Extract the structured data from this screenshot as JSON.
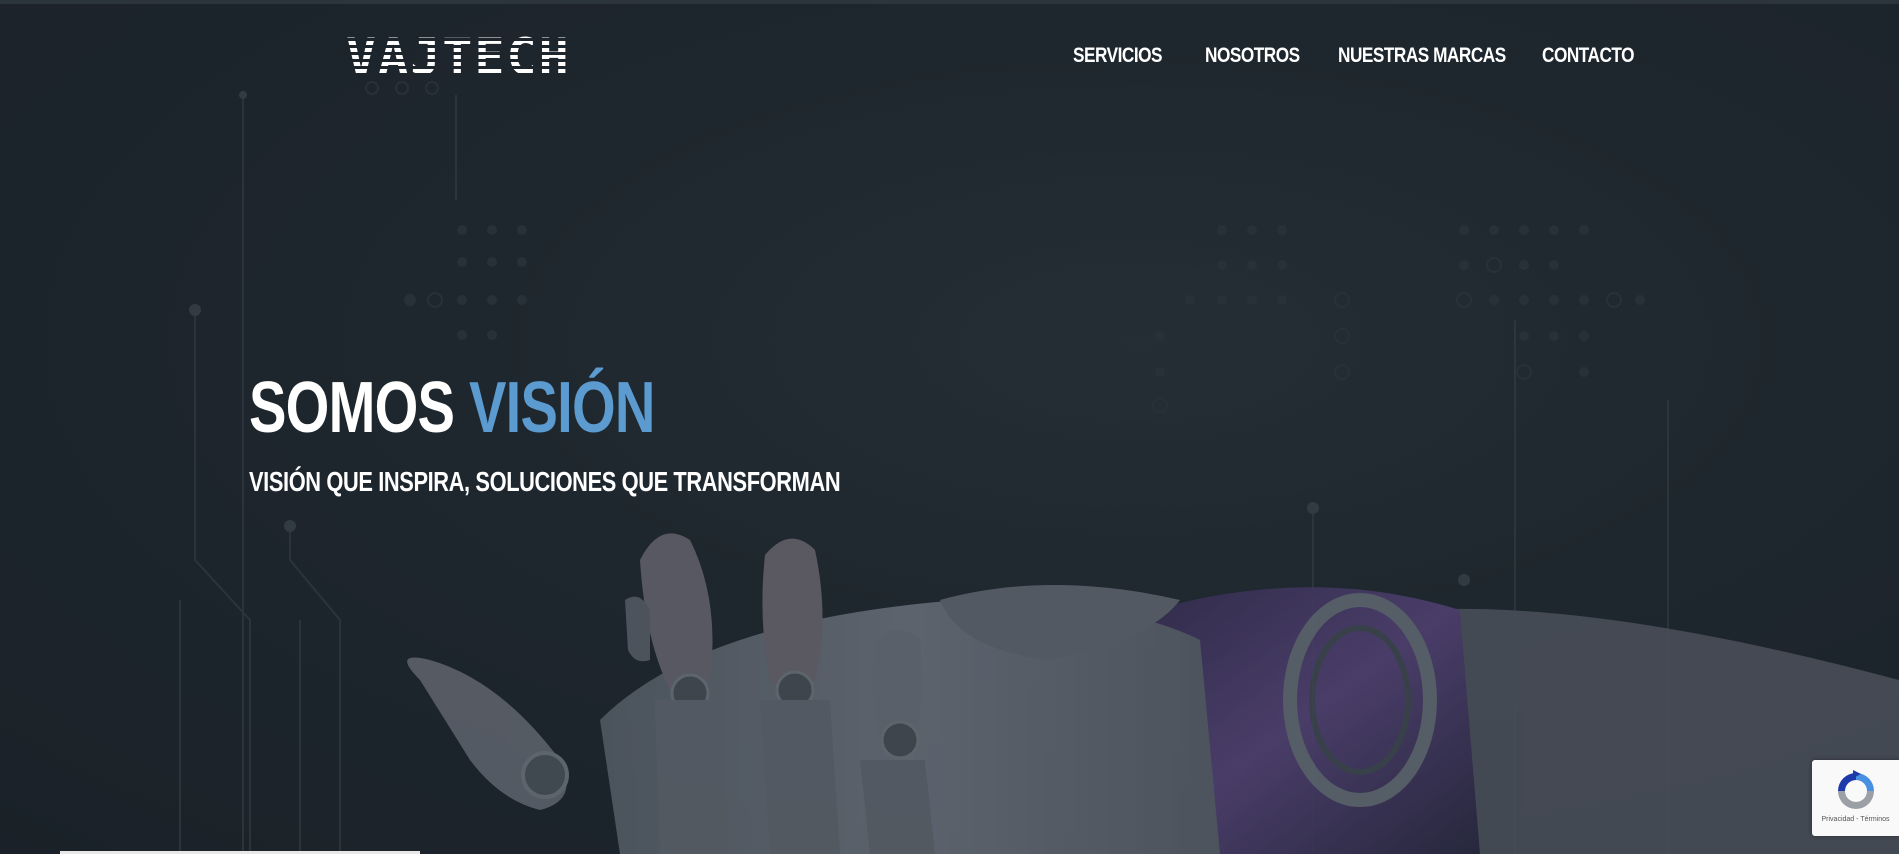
{
  "brand": {
    "logo_text": "VAJTECH"
  },
  "nav": {
    "items": [
      {
        "label": "SERVICIOS"
      },
      {
        "label": "NOSOTROS"
      },
      {
        "label": "NUESTRAS MARCAS"
      },
      {
        "label": "CONTACTO"
      }
    ]
  },
  "hero": {
    "title_prefix": "SOMOS",
    "title_accent": "VISIÓN",
    "subtitle": "VISIÓN QUE INSPIRA, SOLUCIONES QUE TRANSFORMAN",
    "accent_color": "#5b9bd0"
  },
  "recaptcha": {
    "icon": "recaptcha-icon",
    "privacy_label": "Privacidad",
    "separator": "-",
    "terms_label": "Términos"
  }
}
